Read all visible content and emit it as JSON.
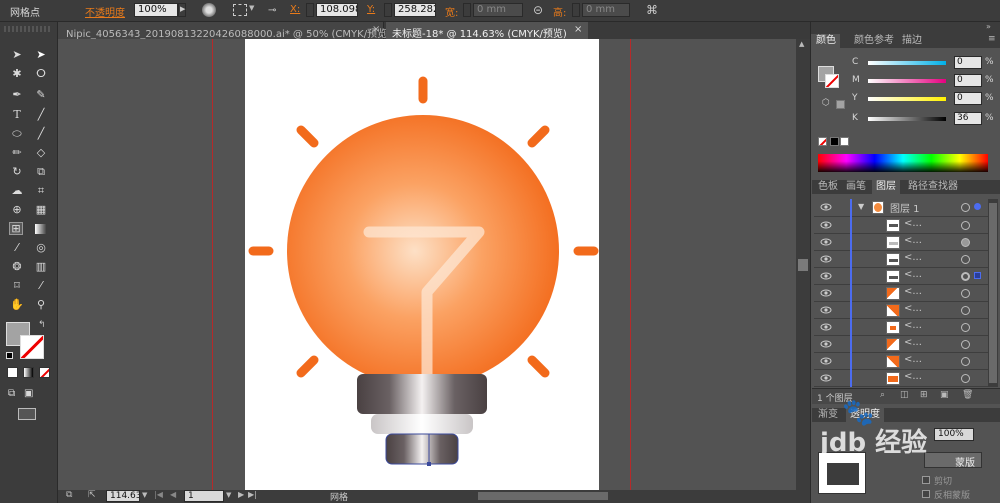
{
  "control_bar": {
    "tool_name": "网格点",
    "opacity_label": "不透明度",
    "opacity_value": "100%",
    "x_label": "X:",
    "x_value": "108.098",
    "y_label": "Y:",
    "y_value": "258.282",
    "width_label": "宽:",
    "width_value": "0 mm",
    "height_label": "高:",
    "height_value": "0 mm"
  },
  "doc_tabs": [
    {
      "label": "Nipic_4056343_20190813220426088000.ai* @ 50% (CMYK/预览)",
      "active": false
    },
    {
      "label": "未标题-18* @ 114.63% (CMYK/预览)",
      "active": true
    }
  ],
  "color_panel": {
    "tabs": [
      "颜色",
      "颜色参考",
      "描边"
    ],
    "channels": [
      {
        "label": "C",
        "value": "0",
        "unit": "%"
      },
      {
        "label": "M",
        "value": "0",
        "unit": "%"
      },
      {
        "label": "Y",
        "value": "0",
        "unit": "%"
      },
      {
        "label": "K",
        "value": "36",
        "unit": "%"
      }
    ]
  },
  "layers_panel": {
    "tabs": [
      "色板",
      "画笔",
      "图层",
      "路径查找器"
    ],
    "layer_name": "图层 1",
    "sublayer_label": "<...",
    "footer": "1 个图层"
  },
  "transparency_panel": {
    "tabs": [
      "渐变",
      "透明度"
    ],
    "opacity": "100%",
    "mask_button": "蒙版",
    "clip_label": "剪切",
    "invert_label": "反相蒙版"
  },
  "status_bar": {
    "zoom": "114.63",
    "page": "1",
    "tool_label": "网格"
  },
  "watermark": {
    "text": "jdb 经验"
  },
  "colors": {
    "ui_bg": "#535353",
    "panel_dark": "#3c3c3c",
    "accent_orange": "#f26a1b",
    "opacity_label_color": "#e87a1a"
  }
}
